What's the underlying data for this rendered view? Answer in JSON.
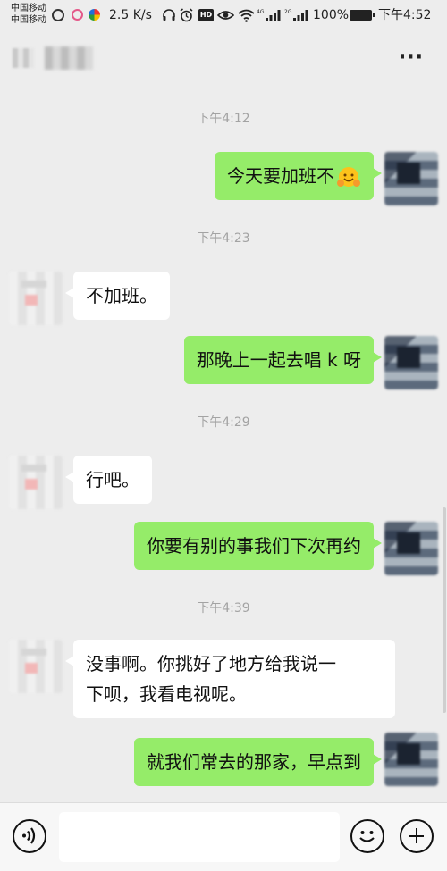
{
  "status_bar": {
    "carrier_1": "中国移动",
    "carrier_2": "中国移动",
    "net_speed": "2.5 K/s",
    "hd_badge": "HD",
    "battery": "100%",
    "time": "下午4:52"
  },
  "header": {
    "more_icon": "more-icon"
  },
  "messages": [
    {
      "type": "time",
      "text": "下午4:12"
    },
    {
      "type": "out",
      "text": "今天要加班不",
      "emoji": "hug-emoji"
    },
    {
      "type": "time",
      "text": "下午4:23"
    },
    {
      "type": "in",
      "text": "不加班。"
    },
    {
      "type": "out",
      "text": "那晚上一起去唱 k 呀"
    },
    {
      "type": "time",
      "text": "下午4:29"
    },
    {
      "type": "in",
      "text": "行吧。"
    },
    {
      "type": "out",
      "text": "你要有别的事我们下次再约"
    },
    {
      "type": "time",
      "text": "下午4:39"
    },
    {
      "type": "in",
      "line1": "没事啊。你挑好了地方给我说一",
      "line2": "下呗，我看电视呢。"
    },
    {
      "type": "out",
      "text": "就我们常去的那家，早点到"
    }
  ],
  "input_bar": {
    "placeholder": "",
    "icons": [
      "voice-icon",
      "emoji-icon",
      "plus-icon"
    ]
  },
  "colors": {
    "outgoing_bubble": "#95ec69",
    "incoming_bubble": "#ffffff",
    "background": "#ededed"
  }
}
